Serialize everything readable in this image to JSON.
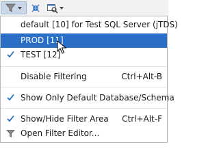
{
  "toolbar": {
    "filter_icon": "filter-icon",
    "collapse_icon": "collapse-all-icon",
    "locate_icon": "locate-icon"
  },
  "menu": {
    "items": [
      {
        "label": "default [10] for Test SQL Server (jTDS)",
        "checked": false,
        "selected": false
      },
      {
        "label": "PROD [11]",
        "checked": false,
        "selected": true
      },
      {
        "label": "TEST [12]",
        "checked": true,
        "selected": false
      },
      {
        "label": "Disable Filtering",
        "shortcut": "Ctrl+Alt-B",
        "checked": false,
        "selected": false
      },
      {
        "label": "Show Only Default Database/Schema",
        "checked": true,
        "selected": false
      },
      {
        "label": "Show/Hide Filter Area",
        "shortcut": "Ctrl+Alt-F",
        "checked": true,
        "selected": false
      },
      {
        "label": "Open Filter Editor...",
        "icon": "filter-icon",
        "checked": false,
        "selected": false
      }
    ]
  },
  "colors": {
    "selection": "#2b6ec5",
    "check": "#2c6fbd",
    "toolbar_bg": "#f2f2f2"
  }
}
